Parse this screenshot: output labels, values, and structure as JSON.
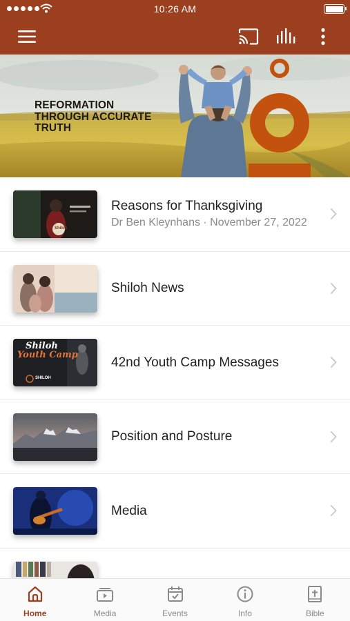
{
  "status_bar": {
    "time": "10:26 AM"
  },
  "app_bar": {
    "menu_icon": "hamburger-menu-icon",
    "cast_icon": "cast-icon",
    "audio_icon": "audio-bars-icon",
    "more_icon": "more-vertical-icon"
  },
  "colors": {
    "brand": "#9c3f1f",
    "accent_orange": "#c4520f",
    "active_tab": "#9c3f1f"
  },
  "hero": {
    "lines": [
      "REFORMATION",
      "THROUGH ACCURATE",
      "TRUTH"
    ]
  },
  "list": {
    "items": [
      {
        "title": "Reasons for Thanksgiving",
        "subtitle": "Dr Ben Kleynhans · November 27, 2022",
        "thumb_text": "Shiloh"
      },
      {
        "title": "Shiloh News",
        "subtitle": ""
      },
      {
        "title": "42nd Youth Camp Messages",
        "subtitle": "",
        "thumb_text_1": "Shiloh",
        "thumb_text_2": "Youth Camp",
        "thumb_text_3": "SHILOH"
      },
      {
        "title": "Position and Posture",
        "subtitle": ""
      },
      {
        "title": "Media",
        "subtitle": ""
      },
      {
        "title": "",
        "subtitle": ""
      }
    ]
  },
  "tabs": [
    {
      "label": "Home",
      "icon": "home-icon",
      "active": true
    },
    {
      "label": "Media",
      "icon": "play-media-icon",
      "active": false
    },
    {
      "label": "Events",
      "icon": "calendar-icon",
      "active": false
    },
    {
      "label": "Info",
      "icon": "info-icon",
      "active": false
    },
    {
      "label": "Bible",
      "icon": "bible-icon",
      "active": false
    }
  ]
}
